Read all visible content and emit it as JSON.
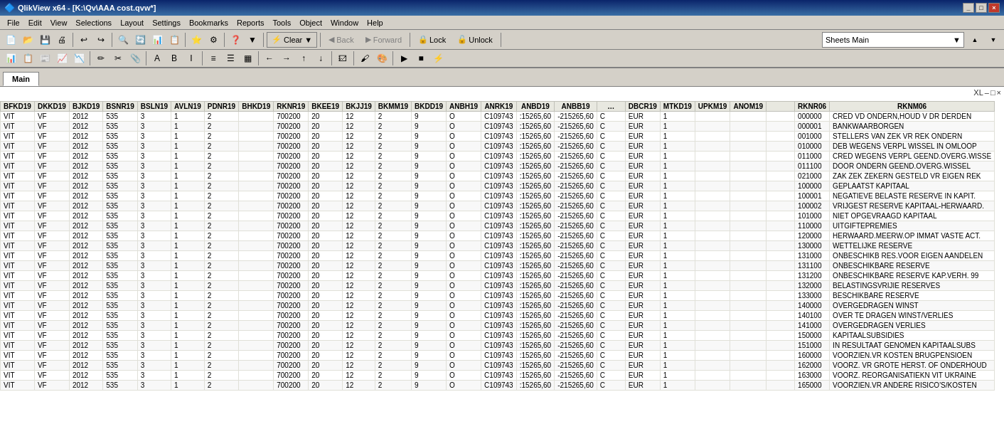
{
  "titlebar": {
    "title": "QlikView x64 - [K:\\Qv\\AAA cost.qvw*]",
    "icon": "Q",
    "buttons": [
      "_",
      "□",
      "×"
    ]
  },
  "menubar": {
    "items": [
      "File",
      "Edit",
      "View",
      "Selections",
      "Layout",
      "Settings",
      "Bookmarks",
      "Reports",
      "Tools",
      "Object",
      "Window",
      "Help"
    ]
  },
  "toolbar1": {
    "clear_label": "Clear",
    "back_label": "Back",
    "forward_label": "Forward",
    "lock_label": "Lock",
    "unlock_label": "Unlock",
    "sheets_label": "Sheets  Main",
    "sheets_dropdown_arrow": "▼"
  },
  "tabs": {
    "items": [
      {
        "label": "Main",
        "active": true
      }
    ]
  },
  "resize_controls": {
    "xl": "XL",
    "min": "–",
    "max": "□",
    "close": "×"
  },
  "table": {
    "columns": [
      "BFKD19",
      "DKKD19",
      "BJKD19",
      "BSNR19",
      "BSLN19",
      "AVLN19",
      "PDNR19",
      "BHKD19",
      "RKNR19",
      "BKEE19",
      "BKJJ19",
      "BKMM19",
      "BKDD19",
      "ANBH19",
      "ANRK19",
      "ANBD19",
      "ANBB19",
      "…",
      "DBCR19",
      "MTKD19",
      "UPKM19",
      "ANOM19",
      "",
      "RKNR06",
      "RKNM06"
    ],
    "rows": [
      [
        "VIT",
        "VF",
        "2012",
        "535",
        "3",
        "1",
        "2",
        "",
        "700200",
        "20",
        "12",
        "2",
        "9",
        "O",
        "C109743",
        ":15265,60",
        "-215265,60",
        "C",
        "EUR",
        "1",
        "",
        "",
        "",
        "000000",
        "CRED VD ONDERN,HOUD V DR DERDEN"
      ],
      [
        "VIT",
        "VF",
        "2012",
        "535",
        "3",
        "1",
        "2",
        "",
        "700200",
        "20",
        "12",
        "2",
        "9",
        "O",
        "C109743",
        ":15265,60",
        "-215265,60",
        "C",
        "EUR",
        "1",
        "",
        "",
        "",
        "000001",
        "BANKWAARBORGEN"
      ],
      [
        "VIT",
        "VF",
        "2012",
        "535",
        "3",
        "1",
        "2",
        "",
        "700200",
        "20",
        "12",
        "2",
        "9",
        "O",
        "C109743",
        ":15265,60",
        "-215265,60",
        "C",
        "EUR",
        "1",
        "",
        "",
        "",
        "001000",
        "STELLERS VAN ZEK VR REK ONDERN"
      ],
      [
        "VIT",
        "VF",
        "2012",
        "535",
        "3",
        "1",
        "2",
        "",
        "700200",
        "20",
        "12",
        "2",
        "9",
        "O",
        "C109743",
        ":15265,60",
        "-215265,60",
        "C",
        "EUR",
        "1",
        "",
        "",
        "",
        "010000",
        "DEB WEGENS VERPL WISSEL IN OMLOOP"
      ],
      [
        "VIT",
        "VF",
        "2012",
        "535",
        "3",
        "1",
        "2",
        "",
        "700200",
        "20",
        "12",
        "2",
        "9",
        "O",
        "C109743",
        ":15265,60",
        "-215265,60",
        "C",
        "EUR",
        "1",
        "",
        "",
        "",
        "011000",
        "CRED WEGENS VERPL GEEND.OVERG.WISSE"
      ],
      [
        "VIT",
        "VF",
        "2012",
        "535",
        "3",
        "1",
        "2",
        "",
        "700200",
        "20",
        "12",
        "2",
        "9",
        "O",
        "C109743",
        ":15265,60",
        "-215265,60",
        "C",
        "EUR",
        "1",
        "",
        "",
        "",
        "011100",
        "DOOR ONDERN GEEND.OVERG.WISSEL"
      ],
      [
        "VIT",
        "VF",
        "2012",
        "535",
        "3",
        "1",
        "2",
        "",
        "700200",
        "20",
        "12",
        "2",
        "9",
        "O",
        "C109743",
        ":15265,60",
        "-215265,60",
        "C",
        "EUR",
        "1",
        "",
        "",
        "",
        "021000",
        "ZAK ZEK ZEKERN GESTELD VR EIGEN REK"
      ],
      [
        "VIT",
        "VF",
        "2012",
        "535",
        "3",
        "1",
        "2",
        "",
        "700200",
        "20",
        "12",
        "2",
        "9",
        "O",
        "C109743",
        ":15265,60",
        "-215265,60",
        "C",
        "EUR",
        "1",
        "",
        "",
        "",
        "100000",
        "GEPLAATST KAPITAAL"
      ],
      [
        "VIT",
        "VF",
        "2012",
        "535",
        "3",
        "1",
        "2",
        "",
        "700200",
        "20",
        "12",
        "2",
        "9",
        "O",
        "C109743",
        ":15265,60",
        "-215265,60",
        "C",
        "EUR",
        "1",
        "",
        "",
        "",
        "100001",
        "NEGATIEVE BELASTE RESERVE IN KAPIT."
      ],
      [
        "VIT",
        "VF",
        "2012",
        "535",
        "3",
        "1",
        "2",
        "",
        "700200",
        "20",
        "12",
        "2",
        "9",
        "O",
        "C109743",
        ":15265,60",
        "-215265,60",
        "C",
        "EUR",
        "1",
        "",
        "",
        "",
        "100002",
        "VRIJGEST RESERVE KAPITAAL-HERWAARD."
      ],
      [
        "VIT",
        "VF",
        "2012",
        "535",
        "3",
        "1",
        "2",
        "",
        "700200",
        "20",
        "12",
        "2",
        "9",
        "O",
        "C109743",
        ":15265,60",
        "-215265,60",
        "C",
        "EUR",
        "1",
        "",
        "",
        "",
        "101000",
        "NIET OPGEVRAAGD KAPITAAL"
      ],
      [
        "VIT",
        "VF",
        "2012",
        "535",
        "3",
        "1",
        "2",
        "",
        "700200",
        "20",
        "12",
        "2",
        "9",
        "O",
        "C109743",
        ":15265,60",
        "-215265,60",
        "C",
        "EUR",
        "1",
        "",
        "",
        "",
        "110000",
        "UITGIFTEPREMIES"
      ],
      [
        "VIT",
        "VF",
        "2012",
        "535",
        "3",
        "1",
        "2",
        "",
        "700200",
        "20",
        "12",
        "2",
        "9",
        "O",
        "C109743",
        ":15265,60",
        "-215265,60",
        "C",
        "EUR",
        "1",
        "",
        "",
        "",
        "120000",
        "HERWAARD.MEERW.OP IMMAT VASTE ACT."
      ],
      [
        "VIT",
        "VF",
        "2012",
        "535",
        "3",
        "1",
        "2",
        "",
        "700200",
        "20",
        "12",
        "2",
        "9",
        "O",
        "C109743",
        ":15265,60",
        "-215265,60",
        "C",
        "EUR",
        "1",
        "",
        "",
        "",
        "130000",
        "WETTELIJKE RESERVE"
      ],
      [
        "VIT",
        "VF",
        "2012",
        "535",
        "3",
        "1",
        "2",
        "",
        "700200",
        "20",
        "12",
        "2",
        "9",
        "O",
        "C109743",
        ":15265,60",
        "-215265,60",
        "C",
        "EUR",
        "1",
        "",
        "",
        "",
        "131000",
        "ONBESCHIKB RES.VOOR EIGEN AANDELEN"
      ],
      [
        "VIT",
        "VF",
        "2012",
        "535",
        "3",
        "1",
        "2",
        "",
        "700200",
        "20",
        "12",
        "2",
        "9",
        "O",
        "C109743",
        ":15265,60",
        "-215265,60",
        "C",
        "EUR",
        "1",
        "",
        "",
        "",
        "131100",
        "ONBESCHIKBARE RESERVE"
      ],
      [
        "VIT",
        "VF",
        "2012",
        "535",
        "3",
        "1",
        "2",
        "",
        "700200",
        "20",
        "12",
        "2",
        "9",
        "O",
        "C109743",
        ":15265,60",
        "-215265,60",
        "C",
        "EUR",
        "1",
        "",
        "",
        "",
        "131200",
        "ONBESCHIKBARE RESERVE KAP.VERH. 99"
      ],
      [
        "VIT",
        "VF",
        "2012",
        "535",
        "3",
        "1",
        "2",
        "",
        "700200",
        "20",
        "12",
        "2",
        "9",
        "O",
        "C109743",
        ":15265,60",
        "-215265,60",
        "C",
        "EUR",
        "1",
        "",
        "",
        "",
        "132000",
        "BELASTINGSVRIJIE RESERVES"
      ],
      [
        "VIT",
        "VF",
        "2012",
        "535",
        "3",
        "1",
        "2",
        "",
        "700200",
        "20",
        "12",
        "2",
        "9",
        "O",
        "C109743",
        ":15265,60",
        "-215265,60",
        "C",
        "EUR",
        "1",
        "",
        "",
        "",
        "133000",
        "BESCHIKBARE RESERVE"
      ],
      [
        "VIT",
        "VF",
        "2012",
        "535",
        "3",
        "1",
        "2",
        "",
        "700200",
        "20",
        "12",
        "2",
        "9",
        "O",
        "C109743",
        ":15265,60",
        "-215265,60",
        "C",
        "EUR",
        "1",
        "",
        "",
        "",
        "140000",
        "OVERGEDRAGEN WINST"
      ],
      [
        "VIT",
        "VF",
        "2012",
        "535",
        "3",
        "1",
        "2",
        "",
        "700200",
        "20",
        "12",
        "2",
        "9",
        "O",
        "C109743",
        ":15265,60",
        "-215265,60",
        "C",
        "EUR",
        "1",
        "",
        "",
        "",
        "140100",
        "OVER TE DRAGEN WINST/VERLIES"
      ],
      [
        "VIT",
        "VF",
        "2012",
        "535",
        "3",
        "1",
        "2",
        "",
        "700200",
        "20",
        "12",
        "2",
        "9",
        "O",
        "C109743",
        ":15265,60",
        "-215265,60",
        "C",
        "EUR",
        "1",
        "",
        "",
        "",
        "141000",
        "OVERGEDRAGEN VERLIES"
      ],
      [
        "VIT",
        "VF",
        "2012",
        "535",
        "3",
        "1",
        "2",
        "",
        "700200",
        "20",
        "12",
        "2",
        "9",
        "O",
        "C109743",
        ":15265,60",
        "-215265,60",
        "C",
        "EUR",
        "1",
        "",
        "",
        "",
        "150000",
        "KAPITAALSUBSIDIES"
      ],
      [
        "VIT",
        "VF",
        "2012",
        "535",
        "3",
        "1",
        "2",
        "",
        "700200",
        "20",
        "12",
        "2",
        "9",
        "O",
        "C109743",
        ":15265,60",
        "-215265,60",
        "C",
        "EUR",
        "1",
        "",
        "",
        "",
        "151000",
        "IN RESULTAAT GENOMEN KAPITAALSUBS"
      ],
      [
        "VIT",
        "VF",
        "2012",
        "535",
        "3",
        "1",
        "2",
        "",
        "700200",
        "20",
        "12",
        "2",
        "9",
        "O",
        "C109743",
        ":15265,60",
        "-215265,60",
        "C",
        "EUR",
        "1",
        "",
        "",
        "",
        "160000",
        "VOORZIEN.VR KOSTEN BRUGPENSIOEN"
      ],
      [
        "VIT",
        "VF",
        "2012",
        "535",
        "3",
        "1",
        "2",
        "",
        "700200",
        "20",
        "12",
        "2",
        "9",
        "O",
        "C109743",
        ":15265,60",
        "-215265,60",
        "C",
        "EUR",
        "1",
        "",
        "",
        "",
        "162000",
        "VOORZ. VR GROTE HERST. OF ONDERHOUD"
      ],
      [
        "VIT",
        "VF",
        "2012",
        "535",
        "3",
        "1",
        "2",
        "",
        "700200",
        "20",
        "12",
        "2",
        "9",
        "O",
        "C109743",
        ":15265,60",
        "-215265,60",
        "C",
        "EUR",
        "1",
        "",
        "",
        "",
        "163000",
        "VOORZ. REORGANISATIEKN VIT UKRAINE"
      ],
      [
        "VIT",
        "VF",
        "2012",
        "535",
        "3",
        "1",
        "2",
        "",
        "700200",
        "20",
        "12",
        "2",
        "9",
        "O",
        "C109743",
        ":15265,60",
        "-215265,60",
        "C",
        "EUR",
        "1",
        "",
        "",
        "",
        "165000",
        "VOORZIEN.VR ANDERE RISICO'S/KOSTEN"
      ]
    ]
  }
}
